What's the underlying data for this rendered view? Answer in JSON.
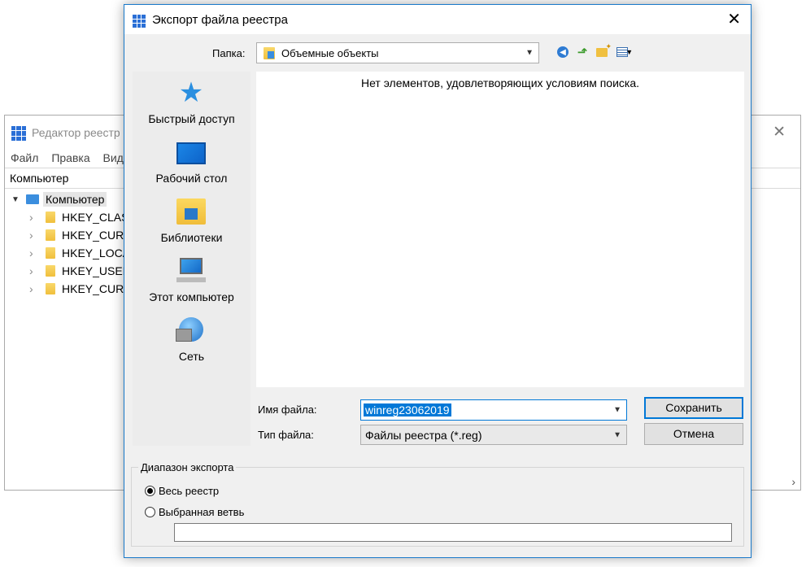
{
  "regedit": {
    "title": "Редактор реестр",
    "menu": [
      "Файл",
      "Правка",
      "Вид"
    ],
    "address": "Компьютер",
    "tree": {
      "root": "Компьютер",
      "children": [
        "HKEY_CLAS",
        "HKEY_CURR",
        "HKEY_LOCA",
        "HKEY_USER",
        "HKEY_CURR"
      ]
    }
  },
  "dialog": {
    "title": "Экспорт файла реестра",
    "folder_label": "Папка:",
    "folder_value": "Объемные объекты",
    "empty_message": "Нет элементов, удовлетворяющих условиям поиска.",
    "places": [
      "Быстрый доступ",
      "Рабочий стол",
      "Библиотеки",
      "Этот компьютер",
      "Сеть"
    ],
    "filename_label": "Имя файла:",
    "filename_value": "winreg23062019",
    "filetype_label": "Тип файла:",
    "filetype_value": "Файлы реестра (*.reg)",
    "save_button": "Сохранить",
    "cancel_button": "Отмена",
    "range": {
      "legend": "Диапазон экспорта",
      "all_label": "Весь реестр",
      "branch_label": "Выбранная ветвь",
      "branch_value": "",
      "selected": "all"
    }
  },
  "icons": {
    "close": "close-icon",
    "back": "back-icon",
    "up": "up-folder-icon",
    "new_folder": "new-folder-icon",
    "view": "view-menu-icon"
  },
  "colors": {
    "accent": "#0078d7",
    "dialog_bg": "#f0f0f0"
  }
}
